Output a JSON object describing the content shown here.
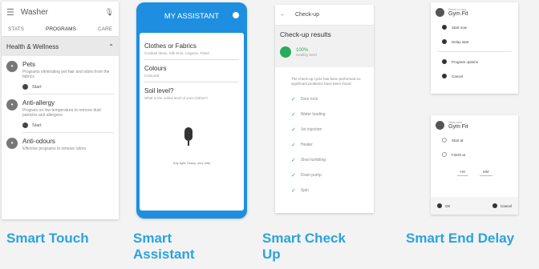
{
  "panel1": {
    "title": "Washer",
    "tabs": [
      "STATS",
      "PROGRAMS",
      "CARE"
    ],
    "section": "Health & Wellness",
    "items": [
      {
        "icon": "paw-icon",
        "name": "Pets",
        "desc": "Programs eliminating pet hair and odors from the fabrics",
        "start": "Start"
      },
      {
        "icon": "leaf-icon",
        "name": "Anti-allergy",
        "desc": "Program on low temperature to remove dust particles and allergens",
        "start": "Start"
      },
      {
        "icon": "drop-icon",
        "name": "Anti-odours",
        "desc": "Effective programs to remove odors",
        "start": ""
      }
    ]
  },
  "panel2": {
    "header": "MY ASSISTANT",
    "fields": [
      {
        "label": "Clothes or Fabrics",
        "sub": "Cocktail dress, Silk Shirt, Lingerie, Fitted"
      },
      {
        "label": "Colours",
        "sub": "Coloured"
      },
      {
        "label": "Soil level?",
        "sub": "What is the soiled level of your clothes?"
      }
    ],
    "hint": "Say light, heavy, very dirty"
  },
  "panel3": {
    "title": "Check-up",
    "results_title": "Check-up results",
    "percent": "100%",
    "state": "Healthy level",
    "message": "The check-up cycle has been performed no significant problems have been found.",
    "checks": [
      "Door lock",
      "Water loading",
      "Jet injection",
      "Heater",
      "Slow tumbling",
      "Drain pump",
      "Spin"
    ]
  },
  "panel4": {
    "small": "Ready to start",
    "name": "Gym Fit",
    "options": [
      "Start now",
      "Delay start",
      "Program options",
      "Cancel"
    ]
  },
  "panel5": {
    "small": "Delay start",
    "name": "Gym Fit",
    "options": [
      "Start at",
      "Finish at"
    ],
    "hh": "HH",
    "mm": "MM",
    "ok": "OK",
    "cancel": "Cancel"
  },
  "captions": {
    "c1": "Smart Touch",
    "c2_line1": "Smart",
    "c2_line2": "Assistant",
    "c3_line1": "Smart Check",
    "c3_line2": "Up",
    "c4": "Smart End Delay"
  }
}
